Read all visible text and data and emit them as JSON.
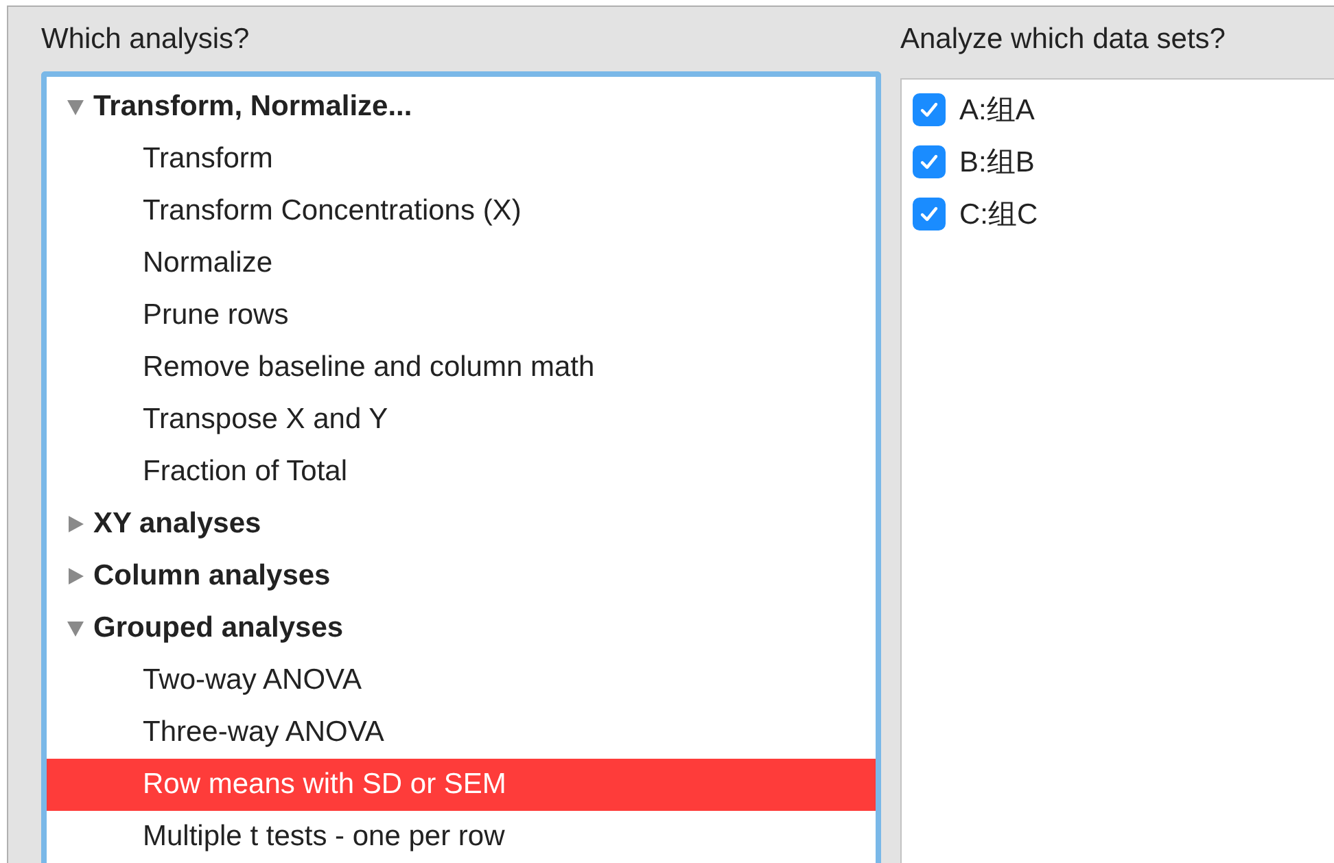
{
  "analysis_panel": {
    "label": "Which analysis?",
    "tree": [
      {
        "label": "Transform, Normalize...",
        "expanded": true,
        "children": [
          {
            "label": "Transform",
            "selected": false
          },
          {
            "label": "Transform Concentrations (X)",
            "selected": false
          },
          {
            "label": "Normalize",
            "selected": false
          },
          {
            "label": "Prune rows",
            "selected": false
          },
          {
            "label": "Remove baseline and column math",
            "selected": false
          },
          {
            "label": "Transpose X and Y",
            "selected": false
          },
          {
            "label": "Fraction of Total",
            "selected": false
          }
        ]
      },
      {
        "label": "XY analyses",
        "expanded": false
      },
      {
        "label": "Column analyses",
        "expanded": false
      },
      {
        "label": "Grouped analyses",
        "expanded": true,
        "children": [
          {
            "label": "Two-way ANOVA",
            "selected": false
          },
          {
            "label": "Three-way ANOVA",
            "selected": false
          },
          {
            "label": "Row means with SD or SEM",
            "selected": true
          },
          {
            "label": "Multiple t tests - one per row",
            "selected": false
          }
        ]
      }
    ]
  },
  "datasets_panel": {
    "label": "Analyze which data sets?",
    "datasets": [
      {
        "label": "A:组A",
        "checked": true
      },
      {
        "label": "B:组B",
        "checked": true
      },
      {
        "label": "C:组C",
        "checked": true
      }
    ]
  }
}
